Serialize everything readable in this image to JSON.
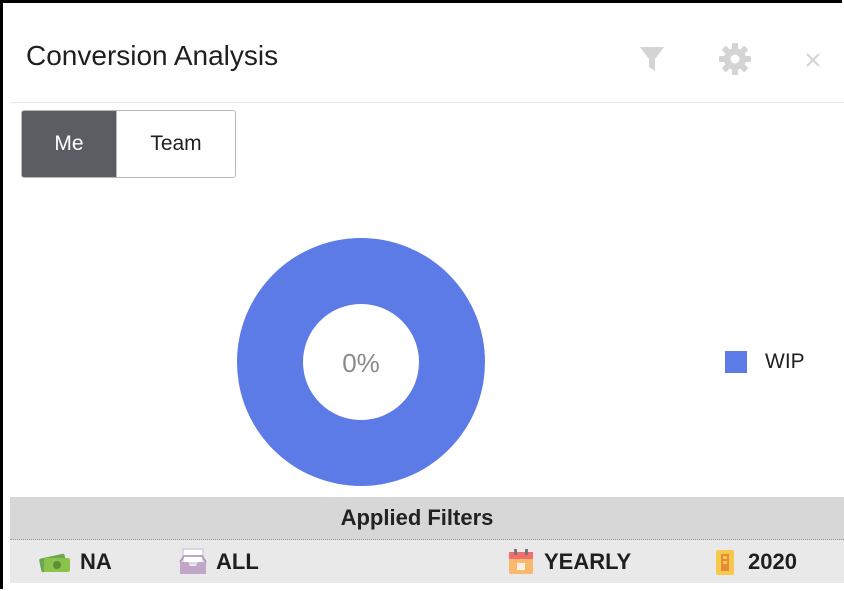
{
  "widget": {
    "title": "Conversion Analysis",
    "header_icons": [
      "filter-icon",
      "gear-icon",
      "close-icon"
    ]
  },
  "toggle": {
    "options": [
      "Me",
      "Team"
    ],
    "selected": "Me"
  },
  "chart_data": {
    "type": "pie",
    "variant": "donut",
    "center_label": "0%",
    "slices": [
      {
        "label": "WIP",
        "value": 100,
        "color": "#5d7be6"
      }
    ],
    "legend_position": "right"
  },
  "applied_filters": {
    "title": "Applied Filters",
    "items": [
      {
        "icon": "money-icon",
        "label": "NA"
      },
      {
        "icon": "inbox-tray-icon",
        "label": "ALL"
      },
      {
        "icon": "calendar-icon",
        "label": "YEARLY"
      },
      {
        "icon": "year-icon",
        "label": "2020"
      }
    ]
  }
}
